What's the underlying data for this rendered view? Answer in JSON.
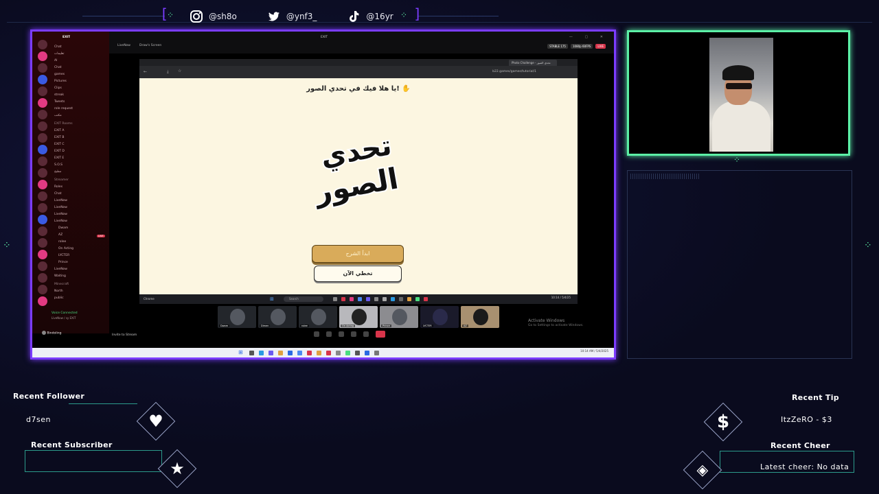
{
  "social": {
    "instagram": "@sh8o",
    "twitter": "@ynf3_",
    "tiktok": "@16yr"
  },
  "discord": {
    "servers_top": "EXIT",
    "channels": [
      "Chat",
      "تعليمات",
      "AI",
      "Chat",
      "games",
      "Pictures",
      "Clips",
      "streak",
      "Tweets",
      "role request",
      "مكتب",
      "EXIT Rooms",
      "EXIT A",
      "EXIT B",
      "EXIT C",
      "EXIT D",
      "EXIT E",
      "S.O.S",
      "مطبخ",
      "Streamer",
      "Roles",
      "Chat",
      "LiveNow",
      "LiveNow",
      "LiveNow",
      "LiveNow",
      "Dwam",
      "AZ",
      "rolee",
      "On Acting",
      "LYCTER",
      "Prince",
      "LiveNow",
      "Waiting",
      "Minecraft",
      "North",
      "public"
    ],
    "voice_connected": "Voice Connected",
    "voice_sub": "LiveNow / sy EXIT",
    "user_name": "Bindoling",
    "top_title": "EXIT",
    "tab_live": "LiveNow",
    "tab_screen": "Draw's Screen",
    "badges": [
      "STABLE 175",
      "1080p 60FPS",
      "LIVE"
    ],
    "invite": "Invite to Stream",
    "live_badge": "LIVE"
  },
  "browser": {
    "tab_title": "Photo Challenge - تحدي الصور",
    "url": "b22.games/games/tutorial/1",
    "greeting": "يا هلا فيك في تحدي الصور!",
    "wave_icon": "waving-hand-icon",
    "logo_line1": "تحدي",
    "logo_line2": "الصور",
    "start_button": "ابدأ الشرح",
    "skip_button": "تخطي الآن",
    "taskbar_search": "Search",
    "taskbar_clock": "10:14 / 5/4/25",
    "taskbar_label": "Chrome"
  },
  "participants": [
    "Dwam",
    "Dimen",
    "rolee",
    "On Acting",
    "Prince",
    "LYCTER",
    "",
    "AZ"
  ],
  "activate": {
    "title": "Activate Windows",
    "sub": "Go to Settings to activate Windows."
  },
  "host_clock": "10:14 AM / 5/4/2025",
  "alerts": {
    "recent_follower_title": "Recent Follower",
    "recent_follower": "d7sen",
    "recent_subscriber_title": "Recent Subscriber",
    "recent_subscriber": "",
    "recent_tip_title": "Recent Tip",
    "recent_tip": "ItzZeRO - $3",
    "recent_cheer_title": "Recent Cheer",
    "recent_cheer": "Latest cheer: No data"
  },
  "colors": {
    "main_border": "#7b3cff",
    "cam_border": "#5cf0a6",
    "accent_teal": "#2c9c8c",
    "background": "#0a0b1e",
    "page_bg": "#fcf6e1",
    "button_gold": "#d9ab5a"
  }
}
